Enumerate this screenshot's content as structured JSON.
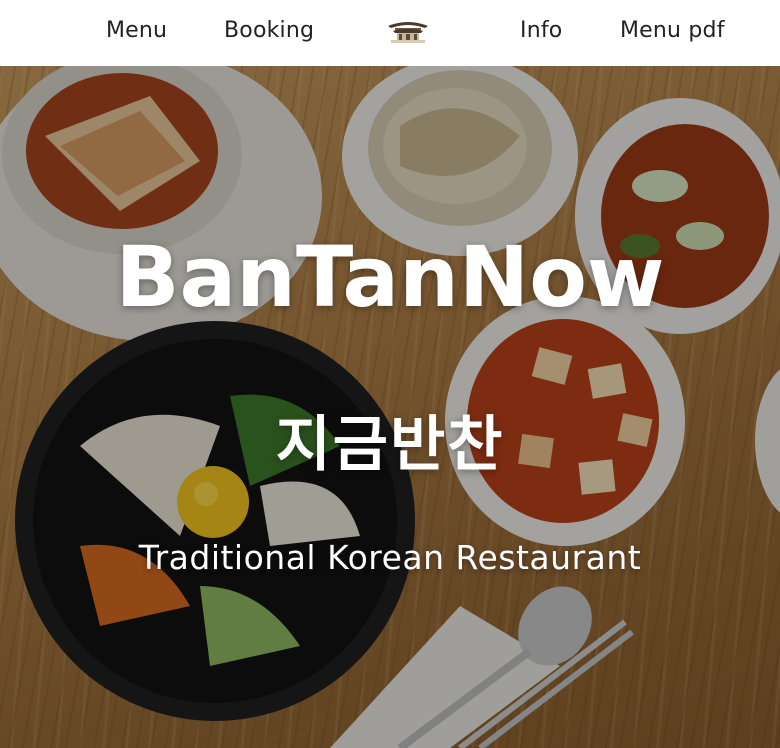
{
  "nav": {
    "left": [
      "Menu",
      "Booking"
    ],
    "right": [
      "Info",
      "Menu pdf"
    ],
    "logo_icon": "korean-gate-pavilion-icon"
  },
  "hero": {
    "title": "BanTanNow",
    "title_korean": "지금반찬",
    "subtitle": "Traditional Korean Restaurant",
    "background_image": "korean-food-table-photo"
  },
  "colors": {
    "nav_text": "#222222",
    "hero_text": "#ffffff",
    "wood": "#b3834a"
  }
}
